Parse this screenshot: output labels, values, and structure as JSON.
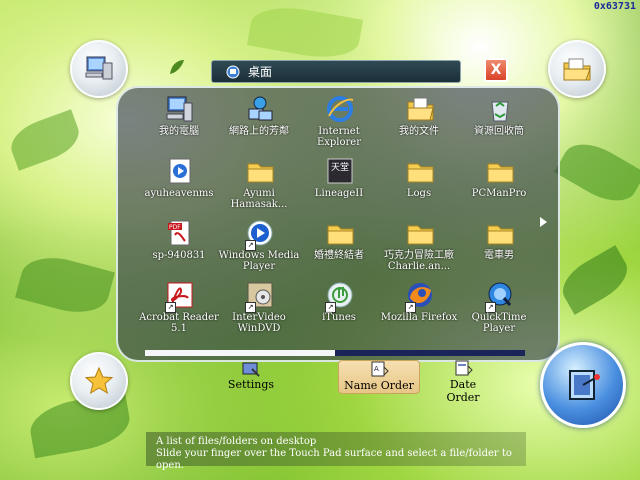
{
  "counter": "0x63731",
  "window": {
    "title": "桌面",
    "close_label": "X"
  },
  "items": [
    {
      "label": "我的電腦",
      "icon": "computer-icon",
      "shortcut": false
    },
    {
      "label": "網路上的芳鄰",
      "icon": "network-icon",
      "shortcut": false
    },
    {
      "label": "Internet Explorer",
      "icon": "ie-icon",
      "shortcut": false
    },
    {
      "label": "我的文件",
      "icon": "documents-folder-icon",
      "shortcut": false
    },
    {
      "label": "資源回收筒",
      "icon": "recycle-bin-icon",
      "shortcut": false
    },
    {
      "label": "ayuheavenms",
      "icon": "media-file-icon",
      "shortcut": false
    },
    {
      "label": "Ayumi Hamasak...",
      "icon": "folder-icon",
      "shortcut": false
    },
    {
      "label": "LineageII",
      "icon": "lineage-icon",
      "shortcut": false
    },
    {
      "label": "Logs",
      "icon": "folder-icon",
      "shortcut": false
    },
    {
      "label": "PCManPro",
      "icon": "folder-icon",
      "shortcut": false
    },
    {
      "label": "sp-940831",
      "icon": "pdf-icon",
      "shortcut": false
    },
    {
      "label": "Windows Media Player",
      "icon": "media-player-icon",
      "shortcut": true
    },
    {
      "label": "婚禮終結者",
      "icon": "folder-icon",
      "shortcut": false
    },
    {
      "label": "巧克力冒險工廠 Charlie.an...",
      "icon": "folder-icon",
      "shortcut": false
    },
    {
      "label": "電車男",
      "icon": "folder-icon",
      "shortcut": false
    },
    {
      "label": "Acrobat Reader 5.1",
      "icon": "acrobat-icon",
      "shortcut": true
    },
    {
      "label": "InterVideo WinDVD",
      "icon": "windvd-icon",
      "shortcut": true
    },
    {
      "label": "iTunes",
      "icon": "itunes-icon",
      "shortcut": true
    },
    {
      "label": "Mozilla Firefox",
      "icon": "firefox-icon",
      "shortcut": true
    },
    {
      "label": "QuickTime Player",
      "icon": "quicktime-icon",
      "shortcut": true
    }
  ],
  "scroll_fraction": 0.5,
  "toolbar": {
    "settings_label": "Settings",
    "name_order_label": "Name Order",
    "date_order_label": "Date Order"
  },
  "hint": {
    "line1": "A list of files/folders on desktop",
    "line2": "Slide your finger over the Touch Pad surface and select a file/folder to open."
  }
}
